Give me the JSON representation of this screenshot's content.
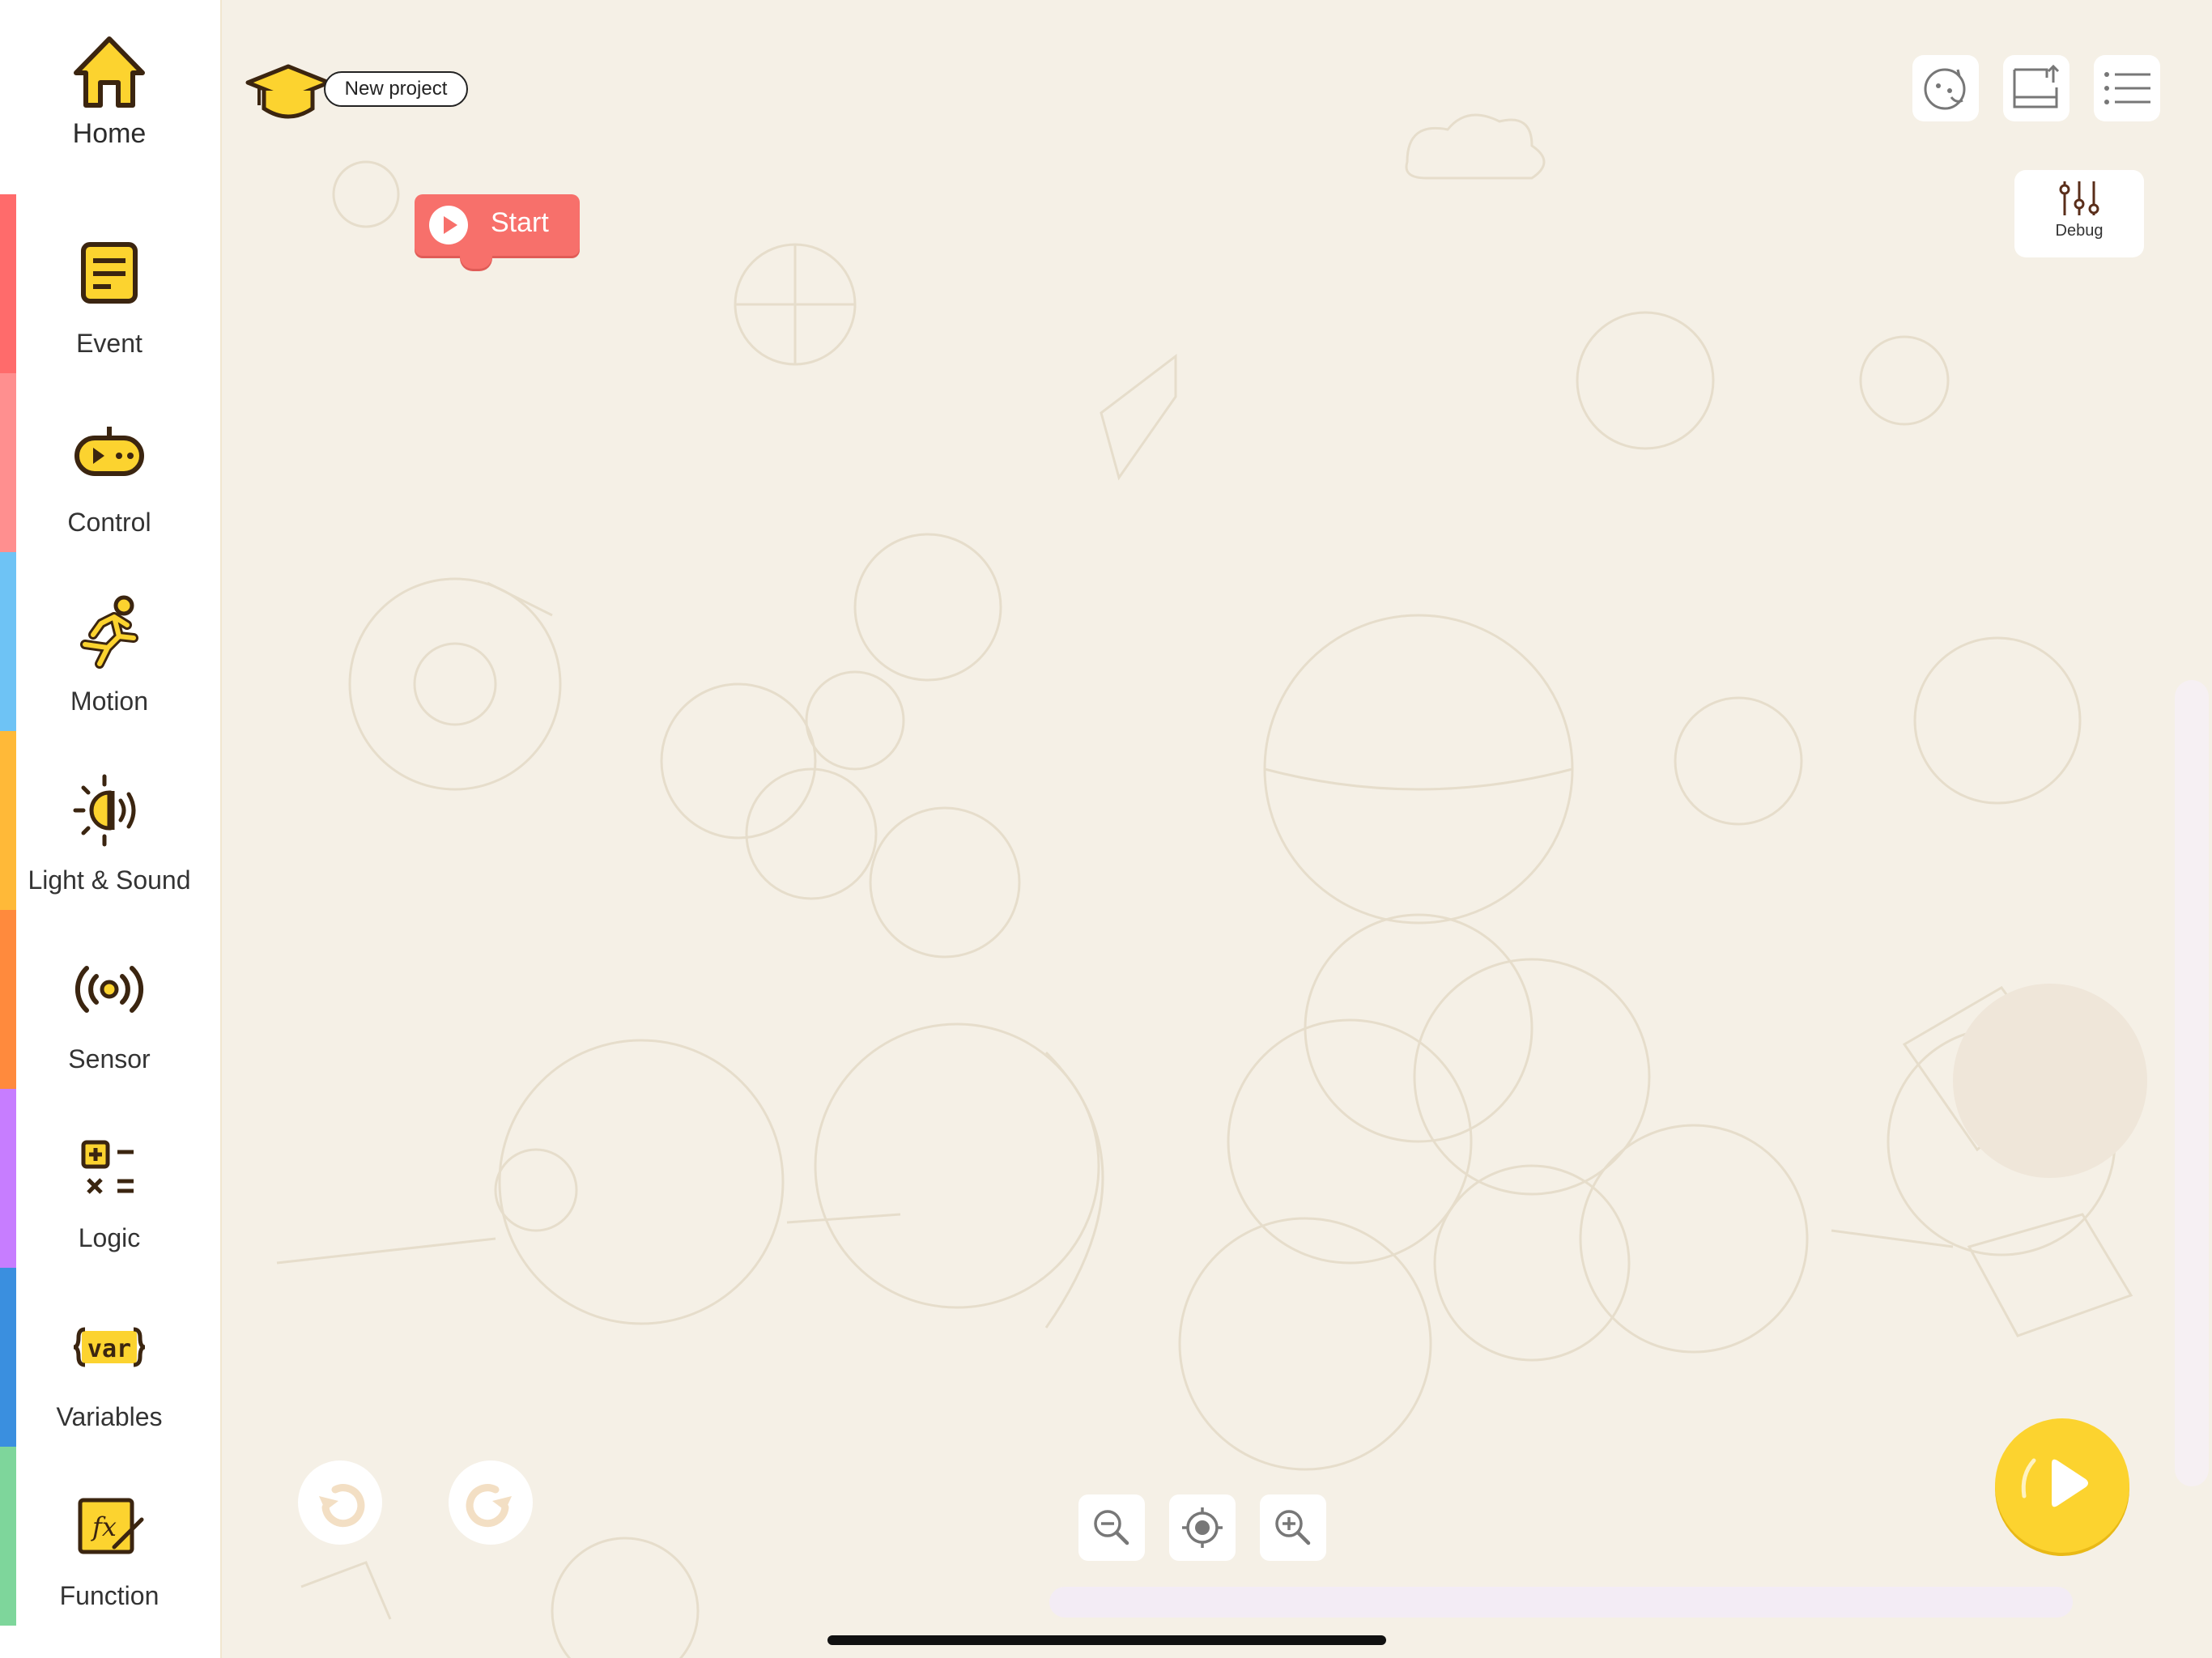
{
  "sidebar": {
    "home_label": "Home",
    "categories": [
      {
        "label": "Event",
        "color": "#ff6b6b"
      },
      {
        "label": "Control",
        "color": "#ff8f8f"
      },
      {
        "label": "Motion",
        "color": "#6ec3f5"
      },
      {
        "label": "Light & Sound",
        "color": "#ffb938"
      },
      {
        "label": "Sensor",
        "color": "#ff8a3d"
      },
      {
        "label": "Logic",
        "color": "#c77dff"
      },
      {
        "label": "Variables",
        "color": "#3a8fdf"
      },
      {
        "label": "Function",
        "color": "#7ed69b"
      }
    ],
    "icon_color": "#fcd32f"
  },
  "header": {
    "project_name": "New project",
    "icons": [
      "face-sync-icon",
      "save-export-icon",
      "menu-list-icon"
    ]
  },
  "canvas": {
    "start_block_label": "Start",
    "start_block_color": "#f7706b"
  },
  "debug": {
    "label": "Debug"
  },
  "controls": {
    "undo": "undo-icon",
    "redo": "redo-icon",
    "zoom_out": "zoom-out-icon",
    "center": "center-target-icon",
    "zoom_in": "zoom-in-icon",
    "run": "play-icon",
    "run_color": "#fcd32f"
  }
}
